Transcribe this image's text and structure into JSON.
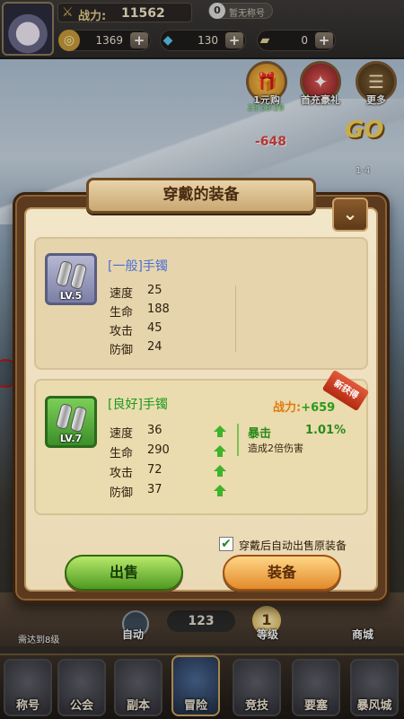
{
  "hud": {
    "power_label": "战力:",
    "power_value": "11562",
    "title_num": "0",
    "title_text": "暂无称号",
    "gold": "1369",
    "diamond": "130",
    "ticket": "0"
  },
  "top_buttons": [
    {
      "label": "1元购",
      "icon": "gift-box-icon"
    },
    {
      "label": "首充豪礼",
      "icon": "winged-shield-icon"
    },
    {
      "label": "更多",
      "icon": "menu-icon"
    }
  ],
  "timer": "23:53:29",
  "scene": {
    "go_text": "GO",
    "stage": "1-4",
    "damage": "-648"
  },
  "modal": {
    "title": "穿戴的装备",
    "current": {
      "level": "LV.5",
      "name": "[一般]手镯",
      "stats": [
        {
          "label": "速度",
          "value": "25"
        },
        {
          "label": "生命",
          "value": "188"
        },
        {
          "label": "攻击",
          "value": "45"
        },
        {
          "label": "防御",
          "value": "24"
        }
      ]
    },
    "new": {
      "level": "LV.7",
      "name": "[良好]手镯",
      "power_label": "战力:",
      "power_gain": "+659",
      "tag": "新获得",
      "stats": [
        {
          "label": "速度",
          "value": "36"
        },
        {
          "label": "生命",
          "value": "290"
        },
        {
          "label": "攻击",
          "value": "72"
        },
        {
          "label": "防御",
          "value": "37"
        }
      ],
      "skill_name": "暴击",
      "skill_value": "1.01%",
      "skill_desc": "造成2倍伤害"
    },
    "auto_sell_label": "穿戴后自动出售原装备",
    "auto_sell_checked": true,
    "sell_button": "出售",
    "equip_button": "装备"
  },
  "strip": {
    "auto_label": "自动",
    "count": "123",
    "level_badge": "1",
    "level_label": "等级",
    "shop_label": "商城",
    "hint": "需达到8级"
  },
  "nav": [
    {
      "label": "称号",
      "icon": "title-icon"
    },
    {
      "label": "公会",
      "icon": "guild-icon"
    },
    {
      "label": "副本",
      "icon": "dungeon-icon"
    },
    {
      "label": "冒险",
      "icon": "adventure-icon"
    },
    {
      "label": "竞技",
      "icon": "arena-icon"
    },
    {
      "label": "要塞",
      "icon": "fortress-icon"
    },
    {
      "label": "暴风城",
      "icon": "stormwind-icon"
    }
  ],
  "colors": {
    "quality_common": "#4a6fd6",
    "quality_good": "#1c9a1c",
    "power_text": "#e07a10",
    "power_gain": "#2a9a1c"
  }
}
